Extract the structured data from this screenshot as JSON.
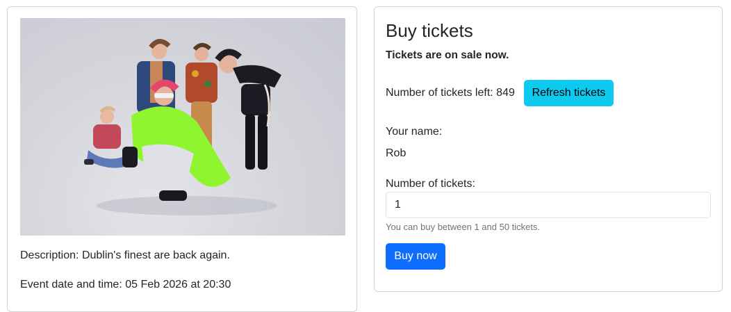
{
  "event": {
    "photo_alt": "Band photo",
    "description_label": "Description:",
    "description": "Dublin's finest are back again.",
    "datetime_label": "Event date and time:",
    "datetime": "05 Feb 2026 at 20:30"
  },
  "buy": {
    "title": "Buy tickets",
    "sale_note": "Tickets are on sale now.",
    "tickets_left_label": "Number of tickets left:",
    "tickets_left": "849",
    "refresh_label": "Refresh tickets",
    "name_label": "Your name:",
    "name_value": "Rob",
    "quantity_label": "Number of tickets:",
    "quantity_value": "1",
    "quantity_help": "You can buy between 1 and 50 tickets.",
    "buy_label": "Buy now"
  },
  "colors": {
    "refresh_button": "#0dcaf0",
    "buy_button": "#0d6efd",
    "help_text": "#6c757d",
    "neon_jacket": "#8ef52f"
  }
}
